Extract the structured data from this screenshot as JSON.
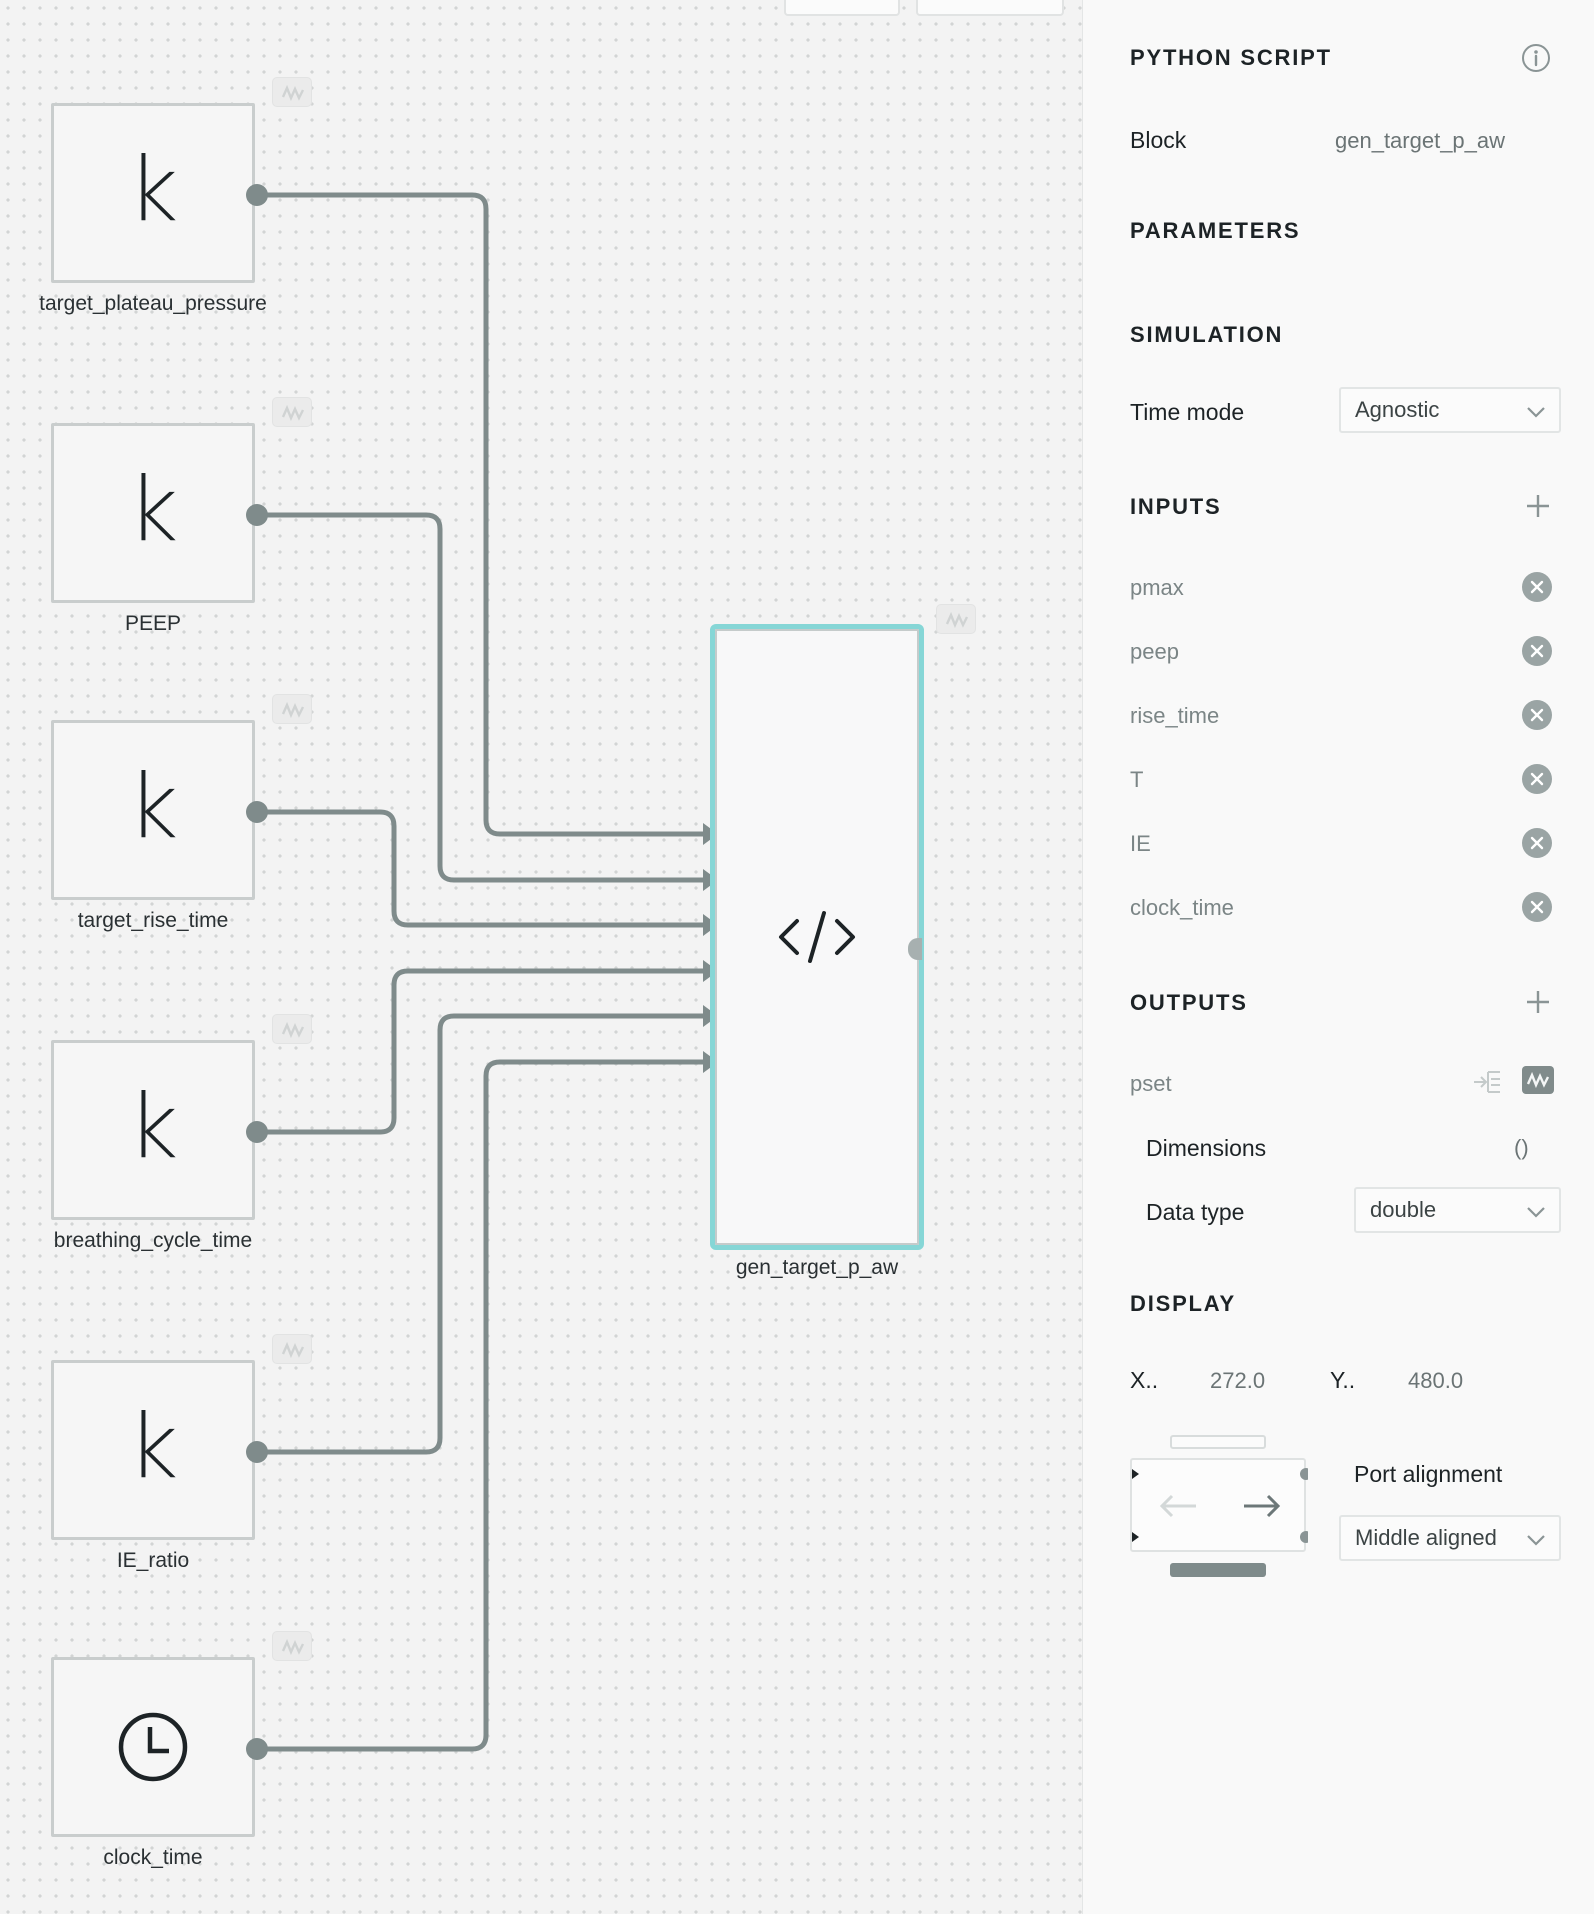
{
  "canvas": {
    "blocks": [
      {
        "icon": "constant-k-icon",
        "glyph": "k",
        "label": "target_plateau_pressure"
      },
      {
        "icon": "constant-k-icon",
        "glyph": "k",
        "label": "PEEP"
      },
      {
        "icon": "constant-k-icon",
        "glyph": "k",
        "label": "target_rise_time"
      },
      {
        "icon": "constant-k-icon",
        "glyph": "k",
        "label": "breathing_cycle_time"
      },
      {
        "icon": "constant-k-icon",
        "glyph": "k",
        "label": "IE_ratio"
      },
      {
        "icon": "clock-icon",
        "glyph": "",
        "label": "clock_time"
      }
    ],
    "python_block": {
      "icon": "code-icon",
      "label": "gen_target_p_aw"
    },
    "colors": {
      "wire": "#7f8b8b",
      "selection": "#86d6d6"
    }
  },
  "panel": {
    "title": "PYTHON SCRIPT",
    "block_label": "Block",
    "block_name": "gen_target_p_aw",
    "parameters_title": "PARAMETERS",
    "simulation_title": "SIMULATION",
    "time_mode_label": "Time mode",
    "time_mode_value": "Agnostic",
    "inputs_title": "INPUTS",
    "inputs": [
      "pmax",
      "peep",
      "rise_time",
      "T",
      "IE",
      "clock_time"
    ],
    "outputs_title": "OUTPUTS",
    "output_name": "pset",
    "dimensions_label": "Dimensions",
    "dimensions_value": "()",
    "data_type_label": "Data type",
    "data_type_value": "double",
    "display_title": "DISPLAY",
    "x_label": "X..",
    "x_value": "272.0",
    "y_label": "Y..",
    "y_value": "480.0",
    "port_alignment_label": "Port alignment",
    "port_alignment_value": "Middle aligned"
  }
}
